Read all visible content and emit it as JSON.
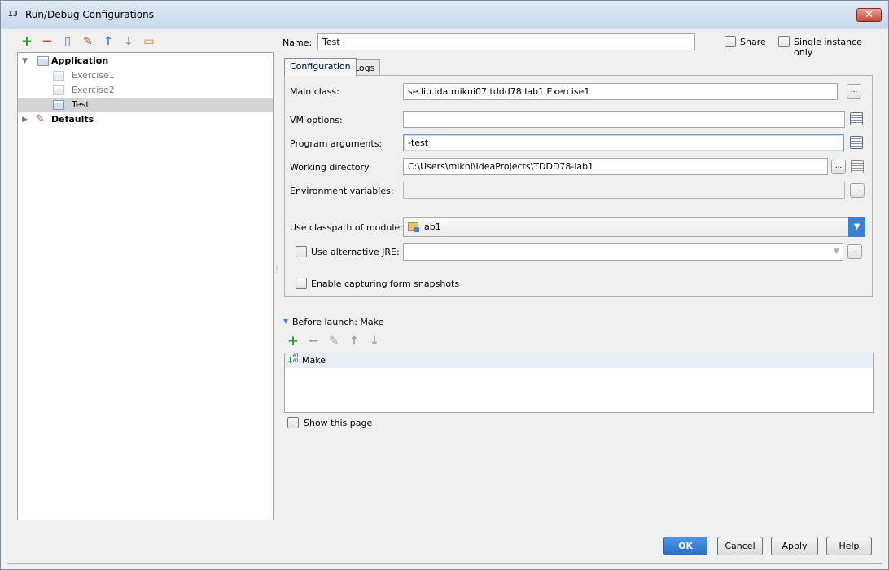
{
  "window": {
    "title": "Run/Debug Configurations",
    "close_glyph": "✕"
  },
  "left_toolbar": {
    "icons": [
      "plus-icon",
      "minus-icon",
      "copy-icon",
      "wrench-icon",
      "arrow-up-icon",
      "arrow-down-icon",
      "folder-icon"
    ]
  },
  "tree": {
    "application_label": "Application",
    "items": [
      {
        "label": "Exercise1"
      },
      {
        "label": "Exercise2"
      },
      {
        "label": "Test"
      }
    ],
    "defaults_label": "Defaults"
  },
  "header": {
    "name_label": "Name:",
    "name_value": "Test",
    "share_label": "Share",
    "single_instance_label": "Single instance only"
  },
  "tabs": [
    {
      "label": "Configuration",
      "active": true
    },
    {
      "label": "Logs",
      "active": false
    }
  ],
  "form": {
    "main_class_label": "Main class:",
    "main_class_value": "se.liu.ida.mikni07.tddd78.lab1.Exercise1",
    "vm_options_label": "VM options:",
    "vm_options_value": "",
    "program_args_label": "Program arguments:",
    "program_args_value": "-test",
    "working_dir_label": "Working directory:",
    "working_dir_value": "C:\\Users\\mikni\\IdeaProjects\\TDDD78-lab1",
    "env_vars_label": "Environment variables:",
    "env_vars_value": "",
    "classpath_label": "Use classpath of module:",
    "classpath_value": "lab1",
    "alt_jre_label": "Use alternative JRE:",
    "alt_jre_value": "",
    "snapshots_label": "Enable capturing form snapshots",
    "ellipsis": "..."
  },
  "before_launch": {
    "title": "Before launch: Make",
    "items": [
      {
        "label": "Make"
      }
    ],
    "show_page_label": "Show this page"
  },
  "footer": {
    "ok": "OK",
    "cancel": "Cancel",
    "apply": "Apply",
    "help": "Help"
  },
  "colors": {
    "selection": "#d4d4d4",
    "primary_button": "#2a6fc9",
    "add_green": "#2f9e2f",
    "remove_red": "#d23a3a",
    "arrow_blue": "#3d86d8"
  }
}
